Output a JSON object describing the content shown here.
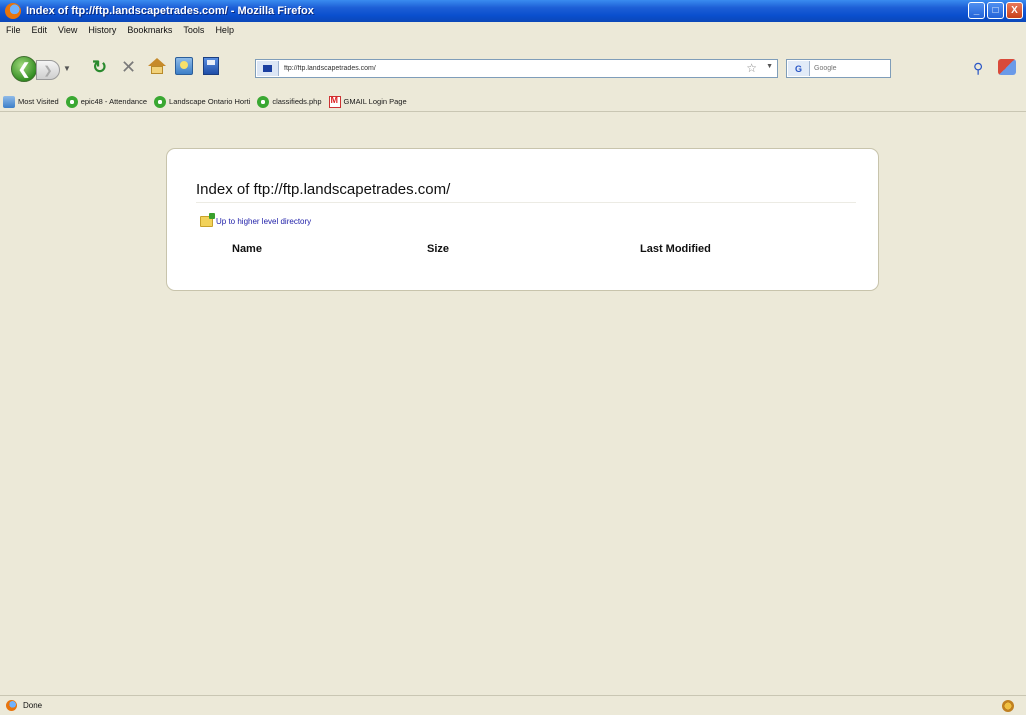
{
  "window": {
    "title": "Index of ftp://ftp.landscapetrades.com/ - Mozilla Firefox",
    "minimize": "_",
    "maximize": "□",
    "close": "X"
  },
  "menu": [
    "File",
    "Edit",
    "View",
    "History",
    "Bookmarks",
    "Tools",
    "Help"
  ],
  "nav": {
    "url": "ftp://ftp.landscapetrades.com/",
    "search_placeholder": "Google",
    "search_engine_icon": "G"
  },
  "bookmarks": [
    {
      "label": "Most Visited",
      "icon": "most-visited-icon"
    },
    {
      "label": "epic48 - Attendance",
      "icon": "landscape-ontario-icon"
    },
    {
      "label": "Landscape Ontario Horti",
      "icon": "landscape-ontario-icon"
    },
    {
      "label": "classifieds.php",
      "icon": "landscape-ontario-icon"
    },
    {
      "label": "GMAIL Login Page",
      "icon": "gmail-icon"
    }
  ],
  "page": {
    "heading": "Index of ftp://ftp.landscapetrades.com/",
    "up_link": "Up to higher level directory",
    "columns": [
      "Name",
      "Size",
      "Last Modified"
    ]
  },
  "status": {
    "text": "Done"
  }
}
